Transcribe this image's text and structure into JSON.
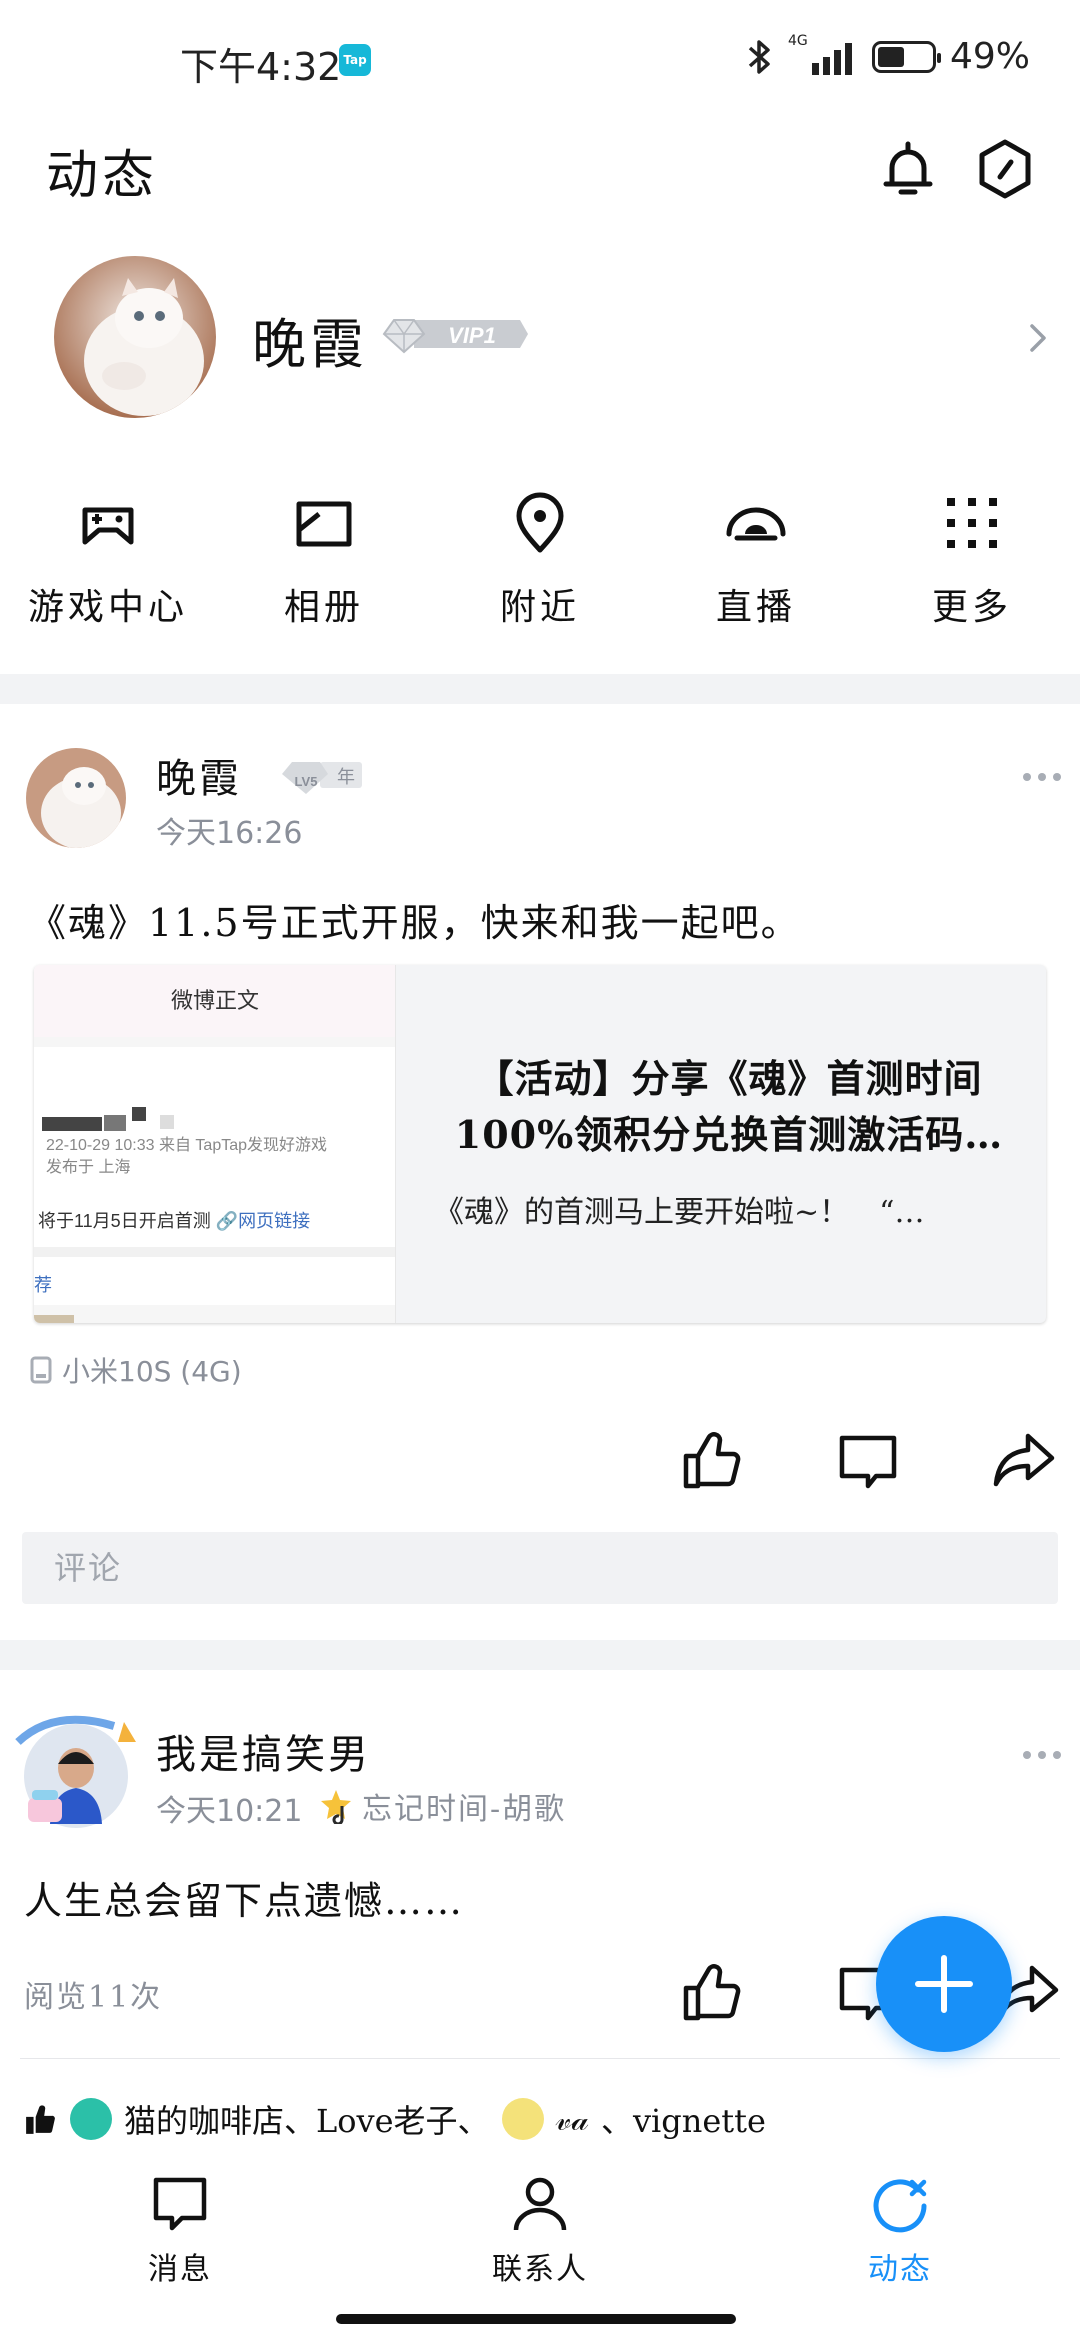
{
  "status_bar": {
    "time": "下午4:32",
    "tap_badge": "Tap",
    "network": "4G",
    "battery": "49%"
  },
  "header": {
    "title": "动态"
  },
  "profile": {
    "name": "晚霞",
    "vip_badge": "VIP1"
  },
  "quick_actions": [
    {
      "label": "游戏中心",
      "icon": "gamepad-icon"
    },
    {
      "label": "相册",
      "icon": "album-icon"
    },
    {
      "label": "附近",
      "icon": "location-pin-icon"
    },
    {
      "label": "直播",
      "icon": "live-icon"
    },
    {
      "label": "更多",
      "icon": "grid-dots-icon"
    }
  ],
  "post1": {
    "author": "晚霞",
    "level_badge": "LV5",
    "year_badge": "年",
    "time": "今天16:26",
    "text": "《魂》11.5号正式开服，快来和我一起吧。",
    "card": {
      "thumb_header": "微博正文",
      "thumb_meta_1": "22-10-29 10:33  来自 TapTap发现好游戏",
      "thumb_meta_2": "发布于 上海",
      "thumb_body": "将于11月5日开启首测 ",
      "thumb_link": "🔗网页链接",
      "thumb_tag": "荐",
      "title_line1": "【活动】分享《魂》首测时间",
      "title_line2": "100%领积分兑换首测激活码…",
      "desc": "《魂》的首测马上要开始啦~！　“…"
    },
    "device": "小米10S (4G)",
    "comment_placeholder": "评论"
  },
  "post2": {
    "author": "我是搞笑男",
    "time": "今天10:21",
    "song": "忘记时间-胡歌",
    "text": "人生总会留下点遗憾……",
    "views": "阅览11次",
    "likes": "猫的咖啡店、Love老子、",
    "likes_tail": "、vignette",
    "likes_sig": "𝓋𝒶"
  },
  "bottom_nav": [
    {
      "label": "消息",
      "icon": "message-icon"
    },
    {
      "label": "联系人",
      "icon": "contacts-icon"
    },
    {
      "label": "动态",
      "icon": "feed-refresh-icon"
    }
  ],
  "colors": {
    "accent": "#1890f8",
    "divider": "#f2f3f5",
    "muted": "#8a8f99"
  }
}
